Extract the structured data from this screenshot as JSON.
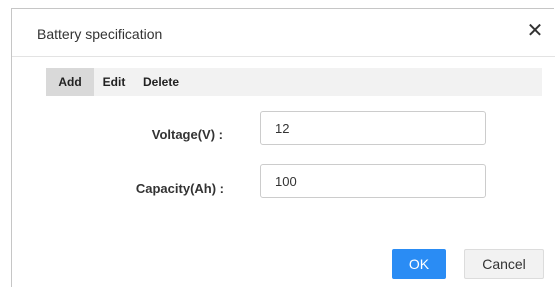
{
  "dialog": {
    "title": "Battery specification",
    "close_glyph": "✕",
    "close_icon": "close-icon"
  },
  "toolbar": {
    "add_label": "Add",
    "edit_label": "Edit",
    "delete_label": "Delete",
    "active": "Add"
  },
  "form": {
    "voltage": {
      "label": "Voltage(V) :",
      "value": "12"
    },
    "capacity": {
      "label": "Capacity(Ah) :",
      "value": "100"
    }
  },
  "footer": {
    "ok_label": "OK",
    "cancel_label": "Cancel"
  },
  "colors": {
    "primary": "#2a8cf4",
    "toolbar_bg": "#f2f2f2",
    "active_tab_bg": "#d9d9d9"
  }
}
